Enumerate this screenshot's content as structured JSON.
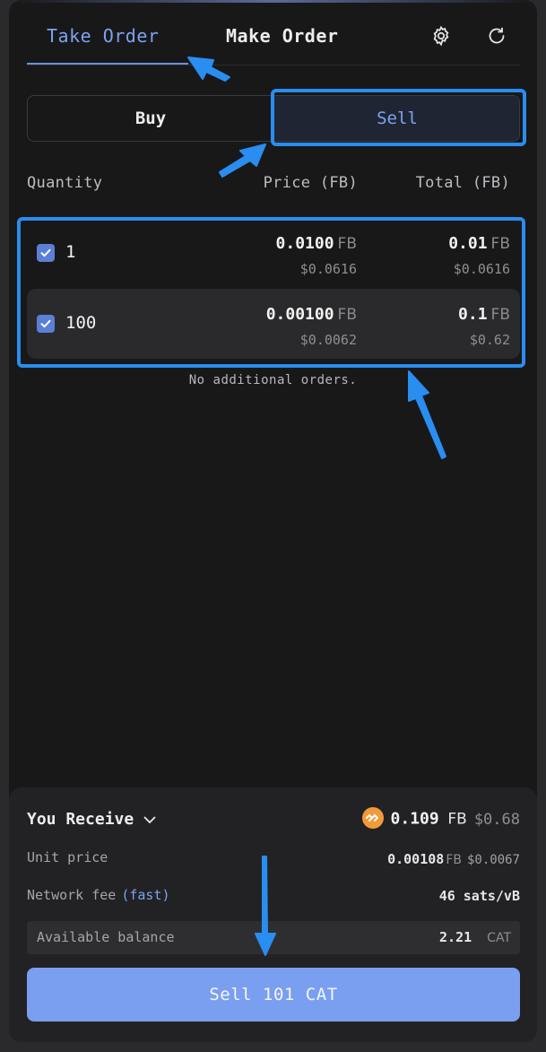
{
  "tabs": {
    "take": "Take Order",
    "make": "Make Order"
  },
  "icons": {
    "settings": "gear-icon",
    "refresh": "refresh-icon",
    "checkbox": "check-icon",
    "coin": "fb-coin-icon",
    "dropdown": "chevron-down-icon"
  },
  "side": {
    "buy": "Buy",
    "sell": "Sell"
  },
  "columns": {
    "quantity": "Quantity",
    "price": "Price (FB)",
    "total": "Total (FB)"
  },
  "orders": [
    {
      "qty": "1",
      "price": "0.0100",
      "price_unit": "FB",
      "price_usd": "$0.0616",
      "total": "0.01",
      "total_unit": "FB",
      "total_usd": "$0.0616"
    },
    {
      "qty": "100",
      "price": "0.00100",
      "price_unit": "FB",
      "price_usd": "$0.0062",
      "total": "0.1",
      "total_unit": "FB",
      "total_usd": "$0.62"
    }
  ],
  "no_more": "No additional orders.",
  "summary": {
    "receive_label": "You Receive",
    "receive_amount": "0.109",
    "receive_unit": "FB",
    "receive_usd": "$0.68",
    "unit_price_label": "Unit price",
    "unit_price": "0.00108",
    "unit_price_unit": "FB",
    "unit_price_usd": "$0.0067",
    "fee_label": "Network fee",
    "fee_speed": "(fast)",
    "fee_value": "46 sats/vB",
    "balance_label": "Available balance",
    "balance_value": "2.21",
    "balance_unit": "CAT"
  },
  "action": {
    "label": "Sell 101 CAT"
  },
  "colors": {
    "accent": "#7ea2f0",
    "highlight": "#2a8df0",
    "button": "#7a9ff0",
    "coin": "#f29a3a"
  }
}
